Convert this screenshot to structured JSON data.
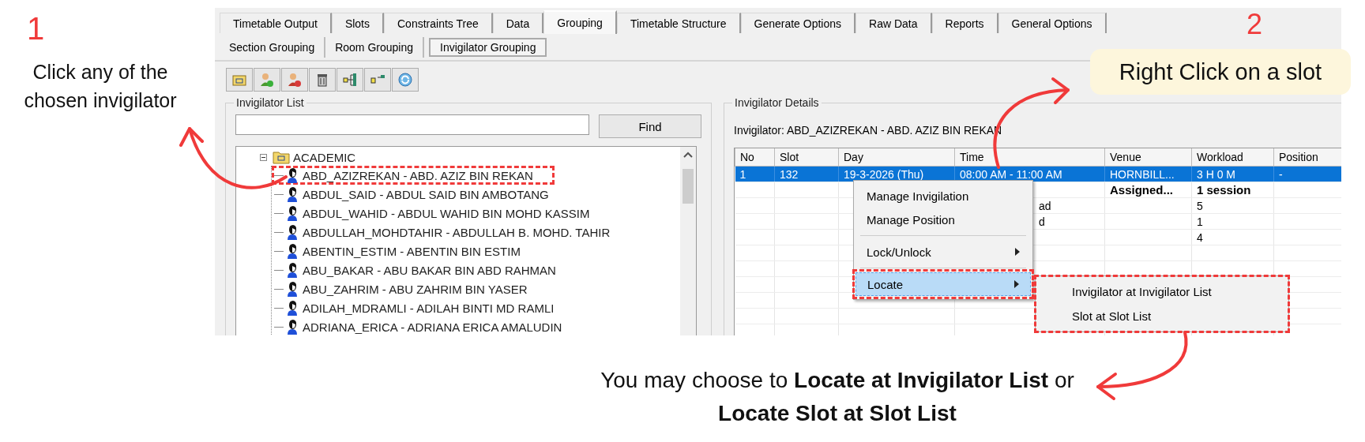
{
  "annotations": {
    "step_1": "1",
    "step_1_text": "Click any of the chosen invigilator",
    "step_2": "2",
    "callout": "Right Click on a slot",
    "footer": "You may choose to **Locate at Invigilator List** or **Locate Slot at Slot List**"
  },
  "tabs": [
    {
      "label": "Timetable Output",
      "selected": false
    },
    {
      "label": "Slots",
      "selected": false
    },
    {
      "label": "Constraints Tree",
      "selected": false
    },
    {
      "label": "Data",
      "selected": false
    },
    {
      "label": "Grouping",
      "selected": true
    },
    {
      "label": "Timetable Structure",
      "selected": false
    },
    {
      "label": "Generate Options",
      "selected": false
    },
    {
      "label": "Raw Data",
      "selected": false
    },
    {
      "label": "Reports",
      "selected": false
    },
    {
      "label": "General Options",
      "selected": false
    }
  ],
  "subtabs": [
    {
      "label": "Section Grouping",
      "selected": false
    },
    {
      "label": "Room Grouping",
      "selected": false
    },
    {
      "label": "Invigilator Grouping",
      "selected": true
    }
  ],
  "invigilator_list": {
    "title": "Invigilator List",
    "find_button": "Find",
    "tree": {
      "label": "ACADEMIC",
      "expanded": true,
      "children": [
        {
          "label": "ABD_AZIZREKAN - ABD. AZIZ BIN REKAN",
          "highlighted": true
        },
        {
          "label": "ABDUL_SAID - ABDUL SAID BIN AMBOTANG",
          "highlighted": false
        },
        {
          "label": "ABDUL_WAHID - ABDUL WAHID BIN MOHD KASSIM",
          "highlighted": false
        },
        {
          "label": "ABDULLAH_MOHDTAHIR - ABDULLAH B. MOHD. TAHIR",
          "highlighted": false
        },
        {
          "label": "ABENTIN_ESTIM - ABENTIN BIN ESTIM",
          "highlighted": false
        },
        {
          "label": "ABU_BAKAR - ABU BAKAR BIN ABD RAHMAN",
          "highlighted": false
        },
        {
          "label": "ABU_ZAHRIM - ABU ZAHRIM BIN YASER",
          "highlighted": false
        },
        {
          "label": "ADILAH_MDRAMLI - ADILAH BINTI MD RAMLI",
          "highlighted": false
        },
        {
          "label": "ADRIANA_ERICA - ADRIANA ERICA AMALUDIN",
          "highlighted": false
        }
      ]
    }
  },
  "invigilator_details": {
    "title": "Invigilator Details",
    "invigilator": "Invigilator: ABD_AZIZREKAN - ABD. AZIZ BIN REKAN",
    "columns": [
      "No",
      "Slot",
      "Day",
      "Time",
      "Venue",
      "Workload",
      "Position"
    ],
    "rows": [
      {
        "no": "1",
        "slot": "132",
        "day": "19-3-2026 (Thu)",
        "time": "08:00 AM - 11:00 AM",
        "venue": "HORNBILL...",
        "workload": "3 H 0 M",
        "position": "-",
        "selected": true,
        "bold": false
      },
      {
        "venue": "Assigned...",
        "workload": "1 session",
        "selected": false,
        "bold": true
      },
      {
        "time": "ad",
        "workload": "5",
        "selected": false,
        "bold": false
      },
      {
        "time": "d",
        "workload": "1",
        "selected": false,
        "bold": false
      },
      {
        "workload": "4",
        "selected": false,
        "bold": false
      }
    ]
  },
  "context_menu": {
    "items": [
      {
        "kind": "item",
        "label": "Manage Invigilation",
        "has_submenu": false,
        "selected": false
      },
      {
        "kind": "item",
        "label": "Manage Position",
        "has_submenu": false,
        "selected": false
      },
      {
        "kind": "separator"
      },
      {
        "kind": "item",
        "label": "Lock/Unlock",
        "has_submenu": true,
        "selected": false
      },
      {
        "kind": "separator"
      },
      {
        "kind": "item",
        "label": "Locate",
        "has_submenu": true,
        "selected": true
      }
    ],
    "submenu": {
      "highlighted": true,
      "items": [
        "Invigilator at Invigilator List",
        "Slot at Slot List"
      ]
    }
  }
}
